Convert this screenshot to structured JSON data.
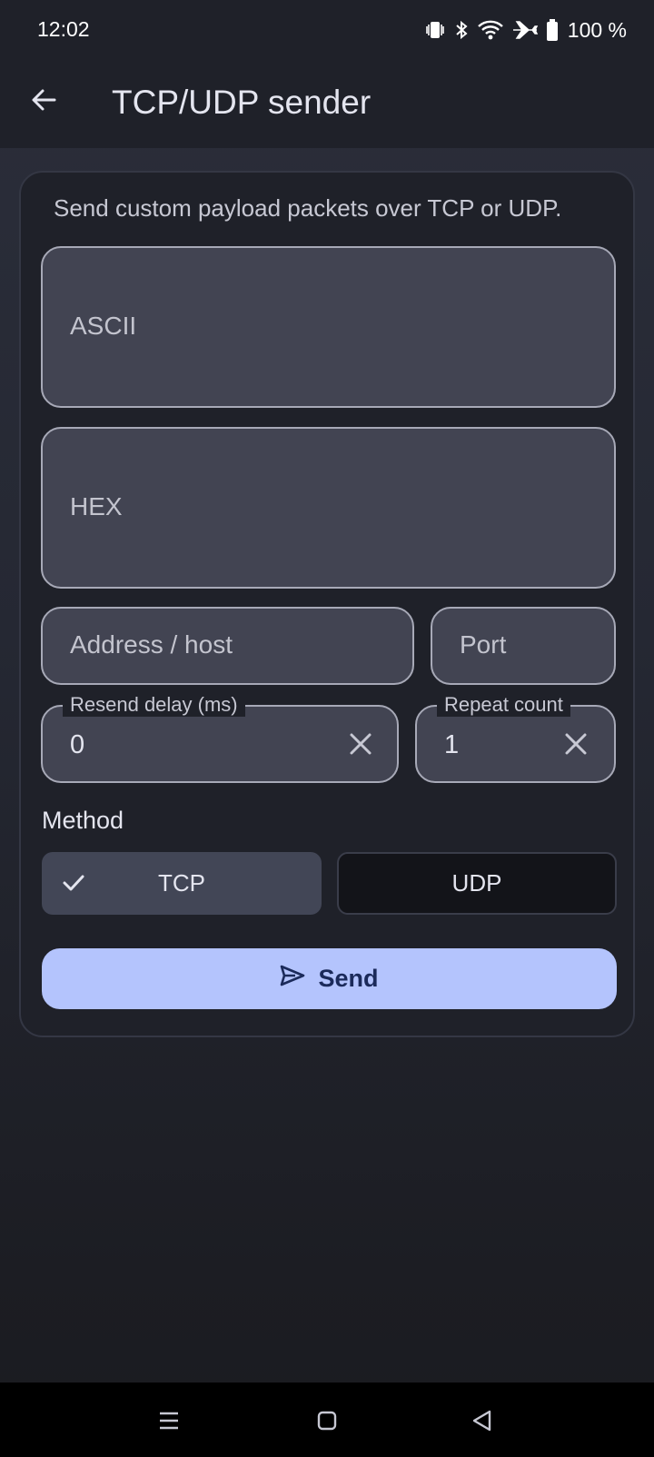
{
  "status_bar": {
    "time": "12:02",
    "battery_percent": "100 %",
    "icons": [
      "vibrate-icon",
      "bluetooth-icon",
      "wifi-icon",
      "airplane-icon",
      "battery-icon"
    ]
  },
  "app_bar": {
    "title": "TCP/UDP sender",
    "back_icon": "arrow-back-icon"
  },
  "card": {
    "description": "Send custom payload packets over TCP or UDP.",
    "ascii_field": {
      "placeholder": "ASCII",
      "value": ""
    },
    "hex_field": {
      "placeholder": "HEX",
      "value": ""
    },
    "address_field": {
      "placeholder": "Address / host",
      "value": ""
    },
    "port_field": {
      "placeholder": "Port",
      "value": ""
    },
    "resend_delay": {
      "label": "Resend delay (ms)",
      "value": "0"
    },
    "repeat_count": {
      "label": "Repeat count",
      "value": "1"
    },
    "method": {
      "label": "Method",
      "options": [
        "TCP",
        "UDP"
      ],
      "selected": "TCP"
    },
    "send_label": "Send"
  },
  "colors": {
    "accent": "#b4c4fd",
    "surface": "#1f2129",
    "field_fill": "#424452",
    "selected_segment": "#424656"
  }
}
